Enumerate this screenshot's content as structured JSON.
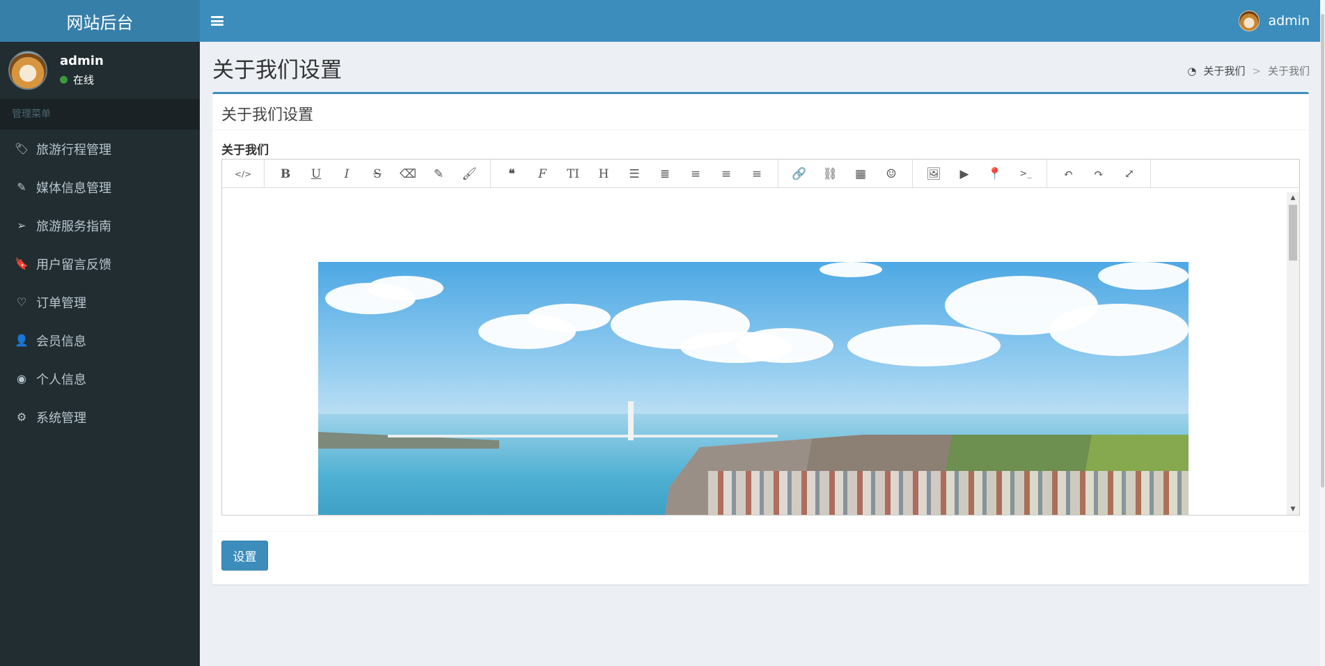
{
  "app": {
    "logo_title": "网站后台"
  },
  "navbar": {
    "user_name": "admin"
  },
  "sidebar": {
    "user_name": "admin",
    "status": "在线",
    "menu_header": "管理菜单",
    "items": [
      {
        "label": "旅游行程管理",
        "icon": "tags-icon"
      },
      {
        "label": "媒体信息管理",
        "icon": "pencil-icon"
      },
      {
        "label": "旅游服务指南",
        "icon": "paper-plane-icon"
      },
      {
        "label": "用户留言反馈",
        "icon": "bookmark-icon"
      },
      {
        "label": "订单管理",
        "icon": "heart-icon"
      },
      {
        "label": "会员信息",
        "icon": "user-icon"
      },
      {
        "label": "个人信息",
        "icon": "user-circle-icon"
      },
      {
        "label": "系统管理",
        "icon": "gear-icon"
      }
    ]
  },
  "page": {
    "title": "关于我们设置",
    "breadcrumb": {
      "home": "关于我们",
      "current": "关于我们"
    }
  },
  "box": {
    "title": "关于我们设置",
    "field_label": "关于我们",
    "submit_label": "设置"
  },
  "editor": {
    "toolbar_icons": [
      "code-view-icon",
      "bold-icon",
      "underline-icon",
      "italic-icon",
      "strikethrough-icon",
      "eraser-icon",
      "pencil-icon",
      "brush-icon",
      "quote-icon",
      "font-icon",
      "text-height-icon",
      "header-icon",
      "bullet-list-icon",
      "numbered-list-icon",
      "align-left-icon",
      "align-center-icon",
      "align-right-icon",
      "link-icon",
      "unlink-icon",
      "table-icon",
      "emoji-icon",
      "image-icon",
      "video-icon",
      "map-marker-icon",
      "terminal-icon",
      "undo-icon",
      "redo-icon",
      "fullscreen-icon"
    ]
  },
  "colors": {
    "primary": "#3c8dbc",
    "sidebar_bg": "#222d32",
    "logo_bg": "#367fa9"
  }
}
